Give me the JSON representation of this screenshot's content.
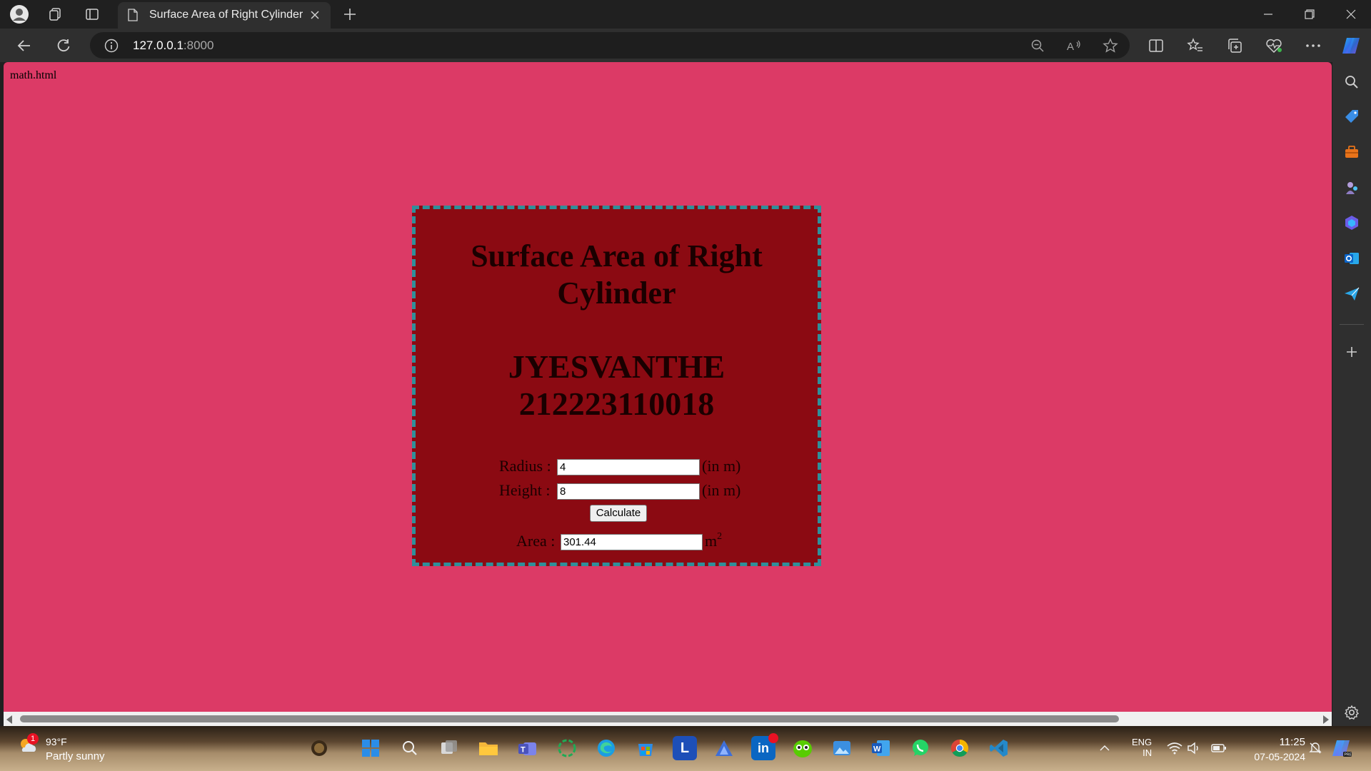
{
  "browser": {
    "tab_title": "Surface Area of Right Cylinder",
    "url_host": "127.0.0.1",
    "url_port": ":8000"
  },
  "page": {
    "file_label": "math.html",
    "title": "Surface Area of Right Cylinder",
    "author_name": "JYESVANTHE",
    "author_id": "212223110018",
    "radius_label": "Radius :",
    "radius_value": "4",
    "radius_unit": "(in m)",
    "height_label": "Height :",
    "height_value": "8",
    "height_unit": "(in m)",
    "calculate_label": "Calculate",
    "area_label": "Area :",
    "area_value": "301.44",
    "area_unit": "m",
    "area_unit_sup": "2"
  },
  "taskbar": {
    "weather_temp": "93°F",
    "weather_desc": "Partly sunny",
    "weather_badge": "1",
    "lang_line1": "ENG",
    "lang_line2": "IN",
    "time": "11:25",
    "date": "07-05-2024"
  },
  "colors": {
    "page_bg": "#dc3a66",
    "card_bg": "#8b0a12",
    "card_border": "#2f8f9a"
  }
}
